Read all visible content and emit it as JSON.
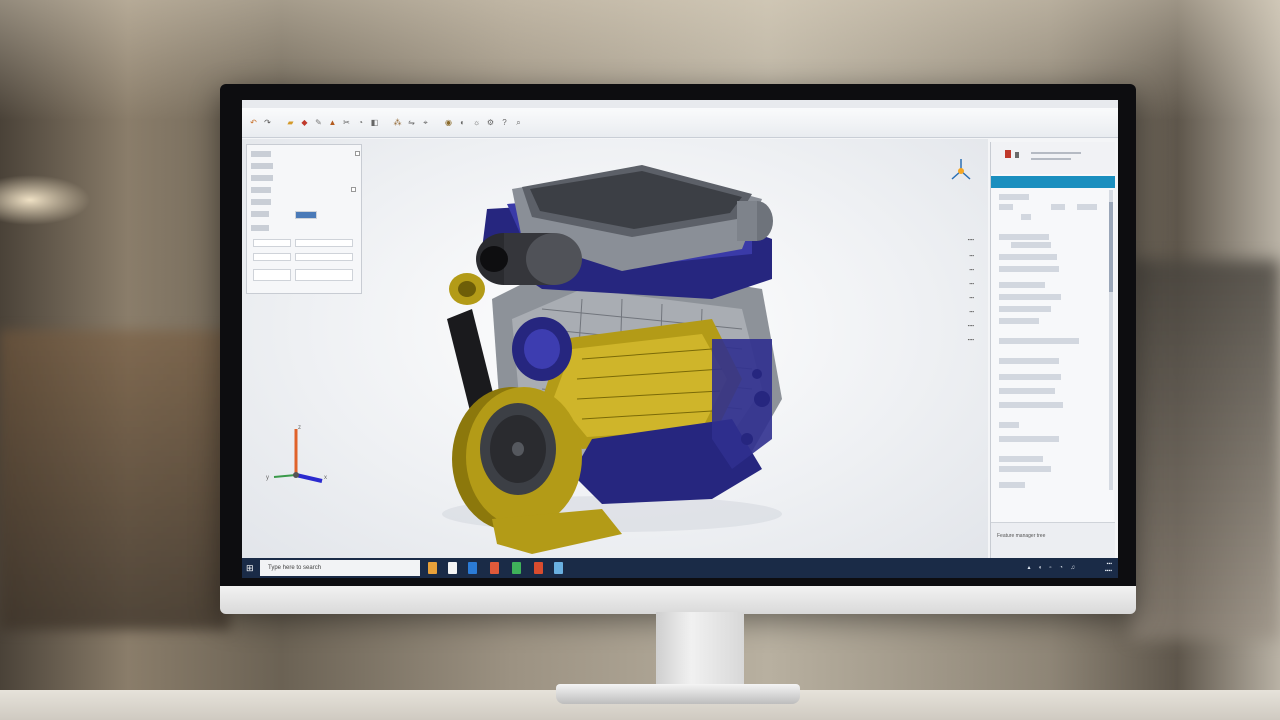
{
  "screen": {
    "toolbar_icons": [
      "undo-icon",
      "redo-icon",
      "open-icon",
      "save-icon",
      "sketch-icon",
      "extrude-icon",
      "cut-icon",
      "fillet-icon",
      "chamfer-icon",
      "pattern-icon",
      "mirror-icon",
      "measure-icon",
      "view-icon",
      "section-icon",
      "render-icon",
      "settings-icon",
      "help-icon",
      "search-icon"
    ],
    "model": {
      "name": "Engine assembly",
      "colors": {
        "gold": "#b39b17",
        "navy": "#26267f",
        "steel": "#8d9299",
        "dark": "#2a2b2f"
      }
    },
    "triad": {
      "x": "x",
      "y": "y",
      "z": "z"
    },
    "taskbar": {
      "search_placeholder": "Type here to search",
      "apps": [
        "#e8a13a",
        "#f5f5f5",
        "#2b7bd6",
        "#e05a3a",
        "#3fb25a",
        "#d94c2e",
        "#6ab0e0"
      ]
    },
    "right_panel": {
      "footer_text": "Feature manager tree"
    }
  }
}
